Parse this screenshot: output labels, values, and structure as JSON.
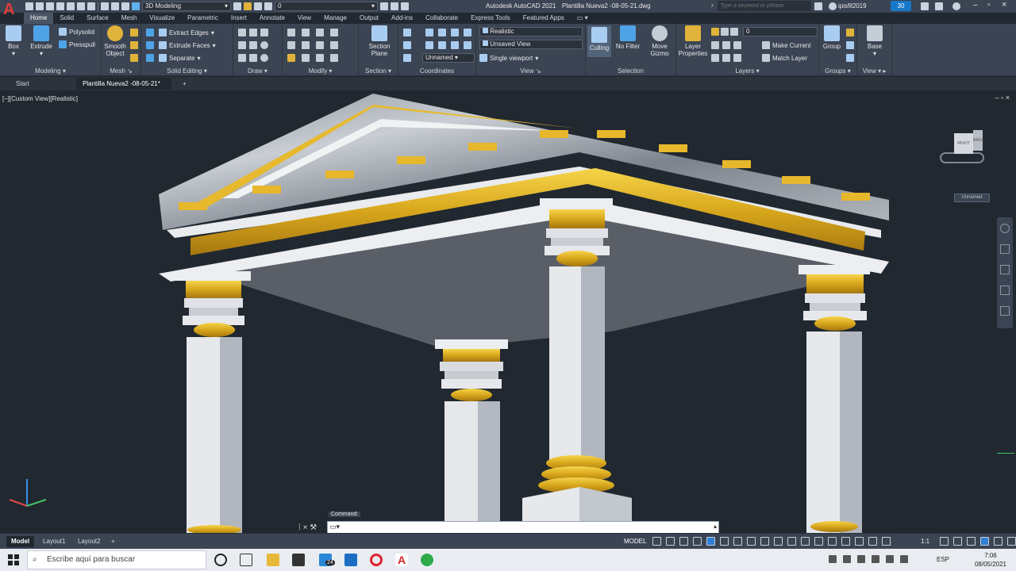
{
  "titlebar": {
    "workspace": "3D Modeling",
    "layer_value": "0",
    "app_title": "Autodesk AutoCAD 2021",
    "file_title": "Plantilla Nueva2 -08-05-21.dwg",
    "search_placeholder": "Type a keyword or phrase",
    "user": "ipisfil2019",
    "timer": "30"
  },
  "tabs": [
    "Home",
    "Solid",
    "Surface",
    "Mesh",
    "Visualize",
    "Parametric",
    "Insert",
    "Annotate",
    "View",
    "Manage",
    "Output",
    "Add-ins",
    "Collaborate",
    "Express Tools",
    "Featured Apps"
  ],
  "ribbon": {
    "modeling": {
      "title": "Modeling",
      "box": "Box",
      "extrude": "Extrude",
      "polysolid": "Polysolid",
      "presspull": "Presspull"
    },
    "mesh": {
      "title": "Mesh",
      "smooth_1": "Smooth",
      "smooth_2": "Object"
    },
    "solid_editing": {
      "title": "Solid Editing",
      "extract_edges": "Extract Edges",
      "extrude_faces": "Extrude Faces",
      "separate": "Separate"
    },
    "draw": {
      "title": "Draw"
    },
    "modify": {
      "title": "Modify"
    },
    "section": {
      "title": "Section",
      "plane_1": "Section",
      "plane_2": "Plane"
    },
    "coordinates": {
      "title": "Coordinates",
      "ucs": "Unnamed"
    },
    "view": {
      "title": "View",
      "visual_style": "Realistic",
      "named_view": "Unsaved View",
      "viewport": "Single viewport"
    },
    "selection": {
      "title": "Selection",
      "culling": "Culling",
      "no_filter": "No Filter",
      "move_1": "Move",
      "move_2": "Gizmo"
    },
    "layers": {
      "title": "Layers",
      "props_1": "Layer",
      "props_2": "Properties",
      "layer_value": "0",
      "make_current": "Make Current",
      "match_layer": "Match Layer"
    },
    "groups": {
      "title": "Groups",
      "group": "Group"
    },
    "view2": {
      "title": "View",
      "base": "Base"
    }
  },
  "doctabs": {
    "start": "Start",
    "file": "Plantilla Nueva2 -08-05-21*"
  },
  "viewport": {
    "label": "[–][Custom View][Realistic]",
    "viewcube_right": "RIGHT",
    "viewcube_back": "BACK",
    "ucs_label": "Unnamed"
  },
  "command": {
    "label": "Command:"
  },
  "layouts": [
    "Model",
    "Layout1",
    "Layout2"
  ],
  "status": {
    "model": "MODEL",
    "scale": "1:1"
  },
  "taskbar": {
    "search": "Escribe aquí para buscar",
    "mail_badge": "24",
    "lang": "ESP",
    "time": "7:06",
    "date": "08/05/2021"
  }
}
